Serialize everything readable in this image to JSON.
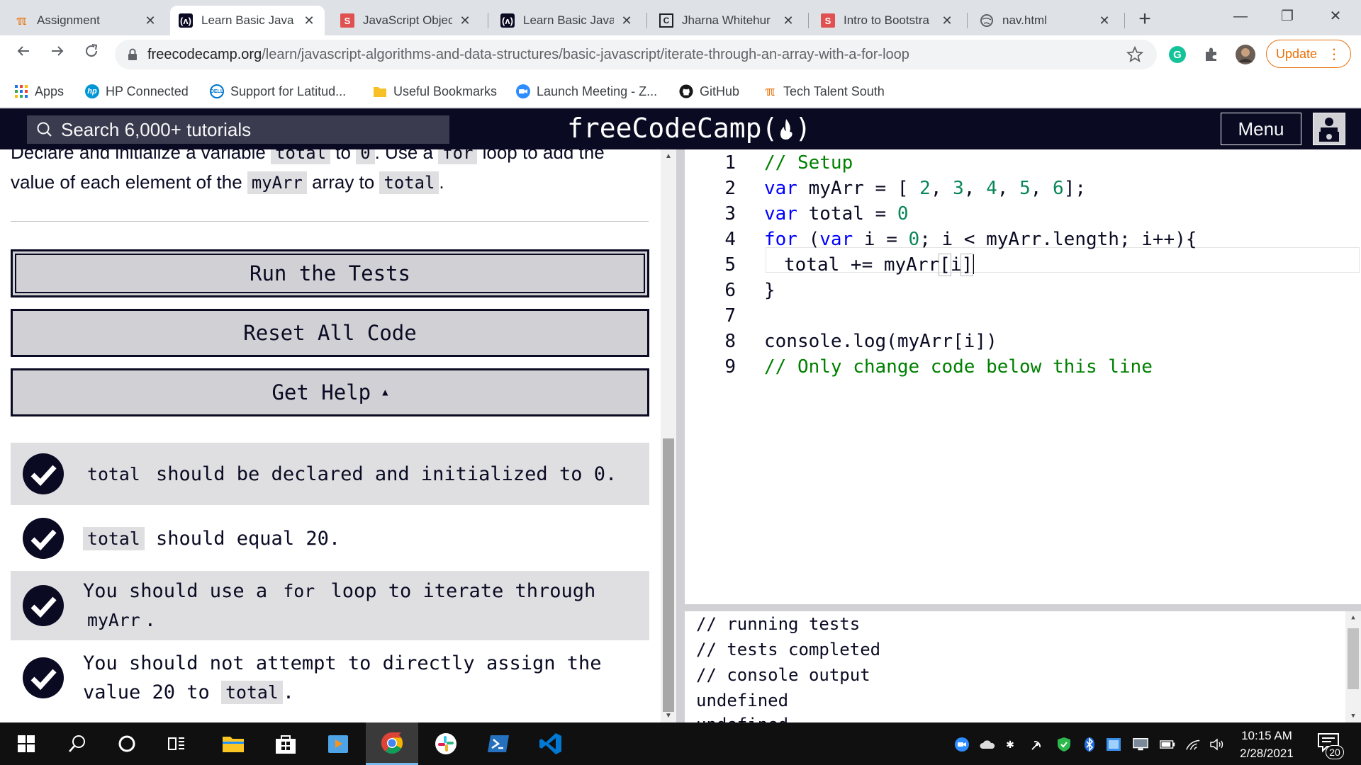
{
  "browser": {
    "tabs": [
      {
        "label": "Assignment",
        "icon": "tech-talent-favicon"
      },
      {
        "label": "Learn Basic Java",
        "icon": "freecodecamp-favicon"
      },
      {
        "label": "JavaScript Objec",
        "icon": "s-favicon"
      },
      {
        "label": "Learn Basic Java",
        "icon": "freecodecamp-favicon"
      },
      {
        "label": "Jharna Whitehur",
        "icon": "code-favicon"
      },
      {
        "label": "Intro to Bootstra",
        "icon": "s-favicon"
      },
      {
        "label": "nav.html",
        "icon": "globe-favicon"
      }
    ],
    "active_tab": 1,
    "url_domain": "freecodecamp.org",
    "url_path": "/learn/javascript-algorithms-and-data-structures/basic-javascript/iterate-through-an-array-with-a-for-loop",
    "update_label": "Update",
    "bookmarks": [
      {
        "label": "Apps",
        "icon": "apps-grid-icon"
      },
      {
        "label": "HP Connected",
        "icon": "hp-icon"
      },
      {
        "label": "Support for Latitud...",
        "icon": "dell-icon"
      },
      {
        "label": "Useful Bookmarks",
        "icon": "folder-icon"
      },
      {
        "label": "Launch Meeting - Z...",
        "icon": "zoom-icon"
      },
      {
        "label": "GitHub",
        "icon": "github-icon"
      },
      {
        "label": "Tech Talent South",
        "icon": "tech-talent-icon"
      }
    ]
  },
  "fcc": {
    "search_placeholder": "Search 6,000+ tutorials",
    "logo_text": "freeCodeCamp(",
    "logo_close": ")",
    "menu_label": "Menu"
  },
  "instructions": {
    "line1_a": "Declare and initialize a variable ",
    "line1_code1": "total",
    "line1_b": " to ",
    "line1_code2": "0",
    "line1_c": ". Use a ",
    "line1_code3": "for",
    "line1_d": " loop to add the",
    "line2_a": "value of each element of the ",
    "line2_code1": "myArr",
    "line2_b": " array to ",
    "line2_code2": "total",
    "line2_c": "."
  },
  "buttons": {
    "run": "Run the Tests",
    "reset": "Reset All Code",
    "help": "Get Help"
  },
  "tests": [
    {
      "code": "total",
      "text": " should be declared and initialized to 0."
    },
    {
      "code": "total",
      "text": " should equal 20."
    },
    {
      "pre": "You should use a ",
      "code": "for",
      "post": " loop to iterate through",
      "code2": "myArr",
      "post2": "."
    },
    {
      "pre": "You should not attempt to directly assign the",
      "line2": "value 20 to ",
      "code": "total",
      "post": "."
    }
  ],
  "editor": {
    "line_numbers": [
      "1",
      "2",
      "3",
      "4",
      "5",
      "6",
      "7",
      "8",
      "9"
    ],
    "lines": {
      "l1": "// Setup",
      "l2_kw": "var",
      "l2_a": " myArr = [ ",
      "l2_n1": "2",
      "l2_n2": "3",
      "l2_n3": "4",
      "l2_n4": "5",
      "l2_n5": "6",
      "l2_sep": ", ",
      "l2_end": "];",
      "l3_kw": "var",
      "l3_a": " total = ",
      "l3_n": "0",
      "l4_kw": "for",
      "l4_a": " (",
      "l4_kw2": "var",
      "l4_b": " i = ",
      "l4_n": "0",
      "l4_c": "; i < myArr.length; i++){",
      "l5_a": "total += myArr",
      "l5_lb": "[",
      "l5_i": "i",
      "l5_rb": "]",
      "l6": "}",
      "l8": "console.log(myArr[i])",
      "l9": "// Only change code below this line"
    }
  },
  "console": {
    "lines": [
      "// running tests",
      "// tests completed",
      "// console output",
      "undefined",
      "undefined"
    ]
  },
  "taskbar": {
    "time": "10:15 AM",
    "date": "2/28/2021",
    "notification_count": "20"
  }
}
